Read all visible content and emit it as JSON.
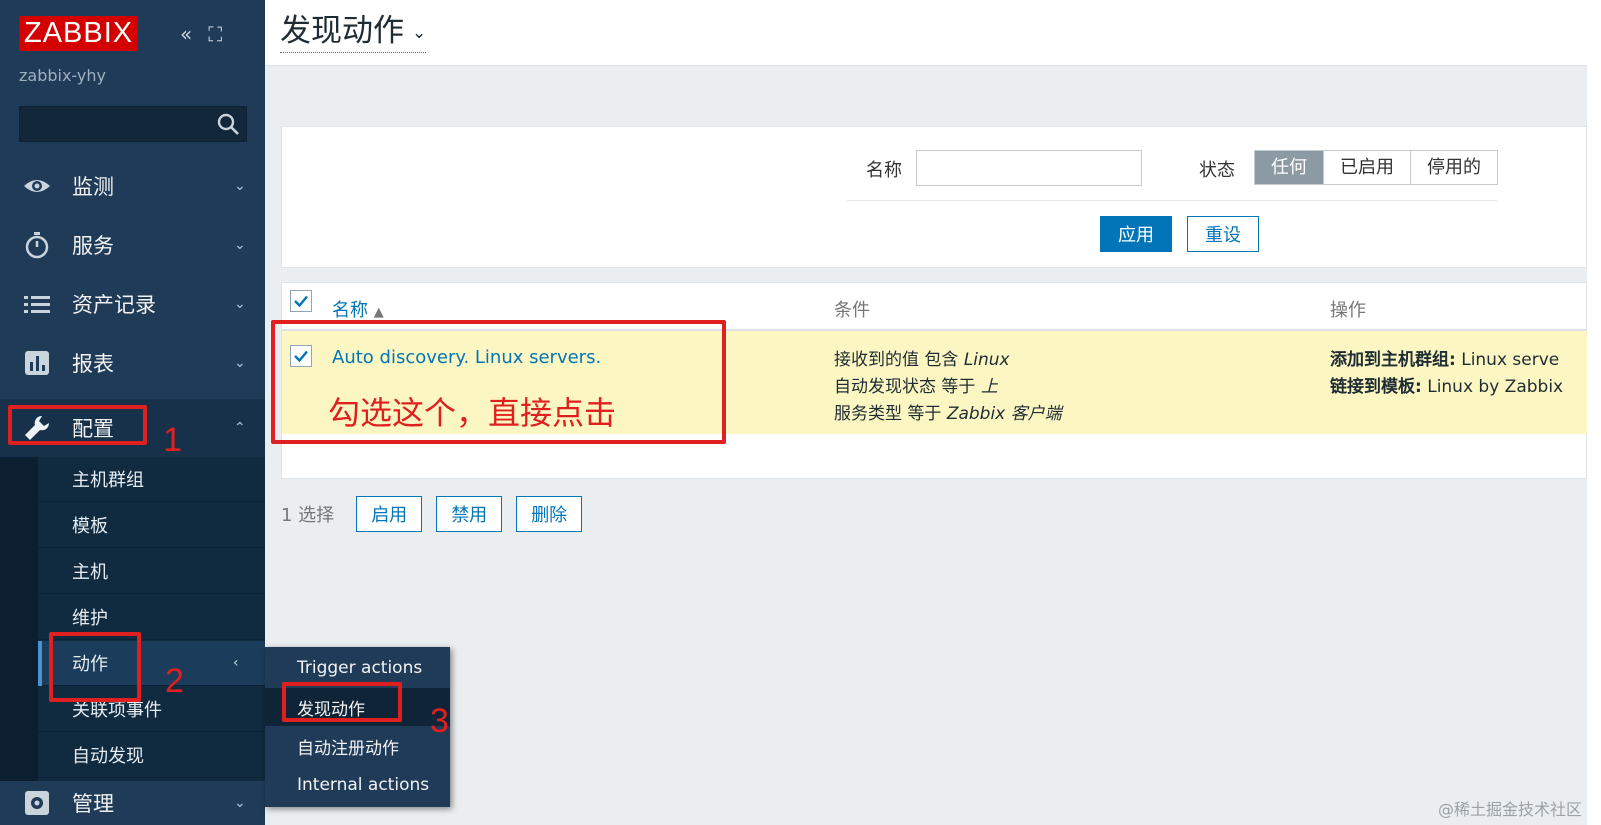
{
  "sidebar": {
    "logo": "ZABBIX",
    "server_name": "zabbix-yhy",
    "search_placeholder": "",
    "menu": [
      {
        "label": "监测",
        "icon": "eye-icon"
      },
      {
        "label": "服务",
        "icon": "stopwatch-icon"
      },
      {
        "label": "资产记录",
        "icon": "list-icon"
      },
      {
        "label": "报表",
        "icon": "bar-chart-icon"
      },
      {
        "label": "配置",
        "icon": "wrench-icon"
      },
      {
        "label": "管理",
        "icon": "gear-icon"
      }
    ],
    "submenu": [
      "主机群组",
      "模板",
      "主机",
      "维护",
      "动作",
      "关联项事件",
      "自动发现"
    ],
    "flyout": [
      "Trigger actions",
      "发现动作",
      "自动注册动作",
      "Internal actions"
    ]
  },
  "header": {
    "title": "发现动作"
  },
  "filter": {
    "name_label": "名称",
    "name_value": "",
    "status_label": "状态",
    "status_options": [
      "任何",
      "已启用",
      "停用的"
    ],
    "status_selected": "任何",
    "apply": "应用",
    "reset": "重设"
  },
  "table": {
    "col_name": "名称",
    "col_conditions": "条件",
    "col_operations": "操作",
    "rows": [
      {
        "name": "Auto discovery. Linux servers.",
        "conditions": [
          {
            "text": "接收到的值 包含 ",
            "value": "Linux"
          },
          {
            "text": "自动发现状态 等于 ",
            "value": "上"
          },
          {
            "text": "服务类型 等于 ",
            "value": "Zabbix 客户端"
          }
        ],
        "operations": [
          {
            "label": "添加到主机群组:",
            "value": " Linux serve"
          },
          {
            "label": "链接到模板:",
            "value": " Linux by Zabbix"
          }
        ]
      }
    ]
  },
  "bottom": {
    "selected": "1 选择",
    "enable": "启用",
    "disable": "禁用",
    "delete": "删除"
  },
  "annotations": {
    "n1": "1",
    "n2": "2",
    "n3": "3",
    "note": "勾选这个，直接点击"
  },
  "watermark": "@稀土掘金技术社区",
  "colors": {
    "brand_red": "#d40000",
    "sidebar": "#1f3b57",
    "link_blue": "#0275b8",
    "row_highlight": "#fcf7c2",
    "annotation_red": "#e02020"
  }
}
